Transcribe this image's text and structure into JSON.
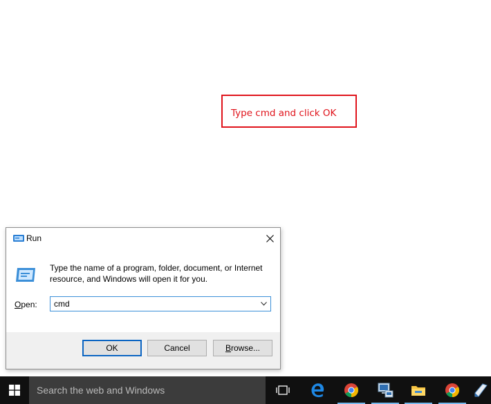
{
  "annotation": {
    "text": "Type cmd and click OK",
    "color": "#e0121a"
  },
  "dialog": {
    "title": "Run",
    "description": "Type the name of a program, folder, document, or Internet resource, and Windows will open it for you.",
    "open_label_mnemonic": "O",
    "open_label_rest": "pen:",
    "input_value": "cmd",
    "buttons": {
      "ok": "OK",
      "cancel": "Cancel",
      "browse_mnemonic": "B",
      "browse_rest": "rowse..."
    },
    "icons": {
      "title": "run-icon",
      "close": "close-icon",
      "dropdown": "chevron-down-icon"
    }
  },
  "taskbar": {
    "search_placeholder": "Search the web and Windows",
    "icons": [
      "windows-start-icon",
      "task-view-icon",
      "edge-icon",
      "chrome-icon",
      "remote-desktop-icon",
      "file-explorer-icon",
      "chrome-icon",
      "pen-icon"
    ],
    "accent": "#76b9ed"
  }
}
